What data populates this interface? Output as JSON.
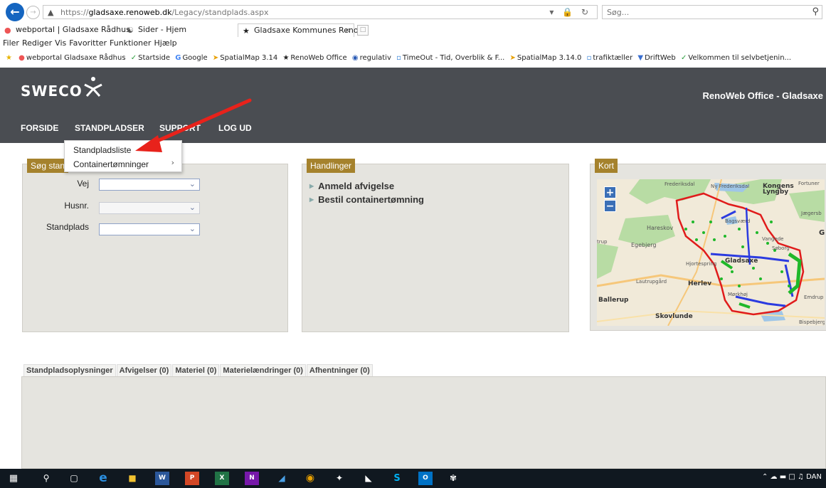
{
  "browser": {
    "url_secure": "https://",
    "url_domain": "gladsaxe.renoweb.dk",
    "url_path": "/Legacy/standplads.aspx",
    "search_placeholder": "Søg..."
  },
  "tabs": [
    {
      "label": "webportal | Gladsaxe Rådhus"
    },
    {
      "label": "Sider - Hjem"
    },
    {
      "label": "Gladsaxe Kommunes Reno..."
    }
  ],
  "menu": [
    "Filer",
    "Rediger",
    "Vis",
    "Favoritter",
    "Funktioner",
    "Hjælp"
  ],
  "favorites": [
    "webportal Gladsaxe Rådhus",
    "Startside",
    "Google",
    "SpatialMap 3.14",
    "RenoWeb Office",
    "regulativ",
    "TimeOut - Tid, Overblik & F...",
    "SpatialMap 3.14.0",
    "trafiktæller",
    "DriftWeb",
    "Velkommen til selvbetjenin..."
  ],
  "site": {
    "logo": "SWECO",
    "title": "RenoWeb Office - Gladsaxe",
    "nav": [
      "FORSIDE",
      "STANDPLADSER",
      "SUPPORT",
      "LOG UD"
    ]
  },
  "dropdown": {
    "items": [
      "Standpladsliste",
      "Containertømninger"
    ]
  },
  "search_panel": {
    "title": "Søg stan",
    "fields": [
      {
        "label": "Vej"
      },
      {
        "label": "Husnr."
      },
      {
        "label": "Standplads"
      }
    ]
  },
  "actions_panel": {
    "title": "Handlinger",
    "items": [
      "Anmeld afvigelse",
      "Bestil containertømning"
    ]
  },
  "map_panel": {
    "title": "Kort",
    "zoom_in": "+",
    "zoom_out": "−",
    "labels": [
      "Frederiksdal",
      "Ny Frederiksdal",
      "Kongens Lyngby",
      "Fortuner",
      "Jægersb",
      "Bagsværd",
      "Hareskov",
      "Egebjerg",
      "Vangede",
      "Gladsaxe",
      "Hjortespring",
      "Lautrupgård",
      "Herlev",
      "Ballerup",
      "Skovlunde",
      "Mørkhøj",
      "Emdrup",
      "Bispebjerg",
      "Søborg",
      "G",
      "trup"
    ]
  },
  "info_tabs": [
    "Standpladsoplysninger",
    "Afvigelser (0)",
    "Materiel (0)",
    "Materielændringer (0)",
    "Afhentninger (0)"
  ],
  "taskbar": {
    "tray_lang": "DAN"
  },
  "colors": {
    "header_bg": "#4a4d52",
    "panel_title_bg": "#a5822d",
    "panel_bg": "#e5e4df",
    "annotation_arrow": "#e8221b"
  }
}
